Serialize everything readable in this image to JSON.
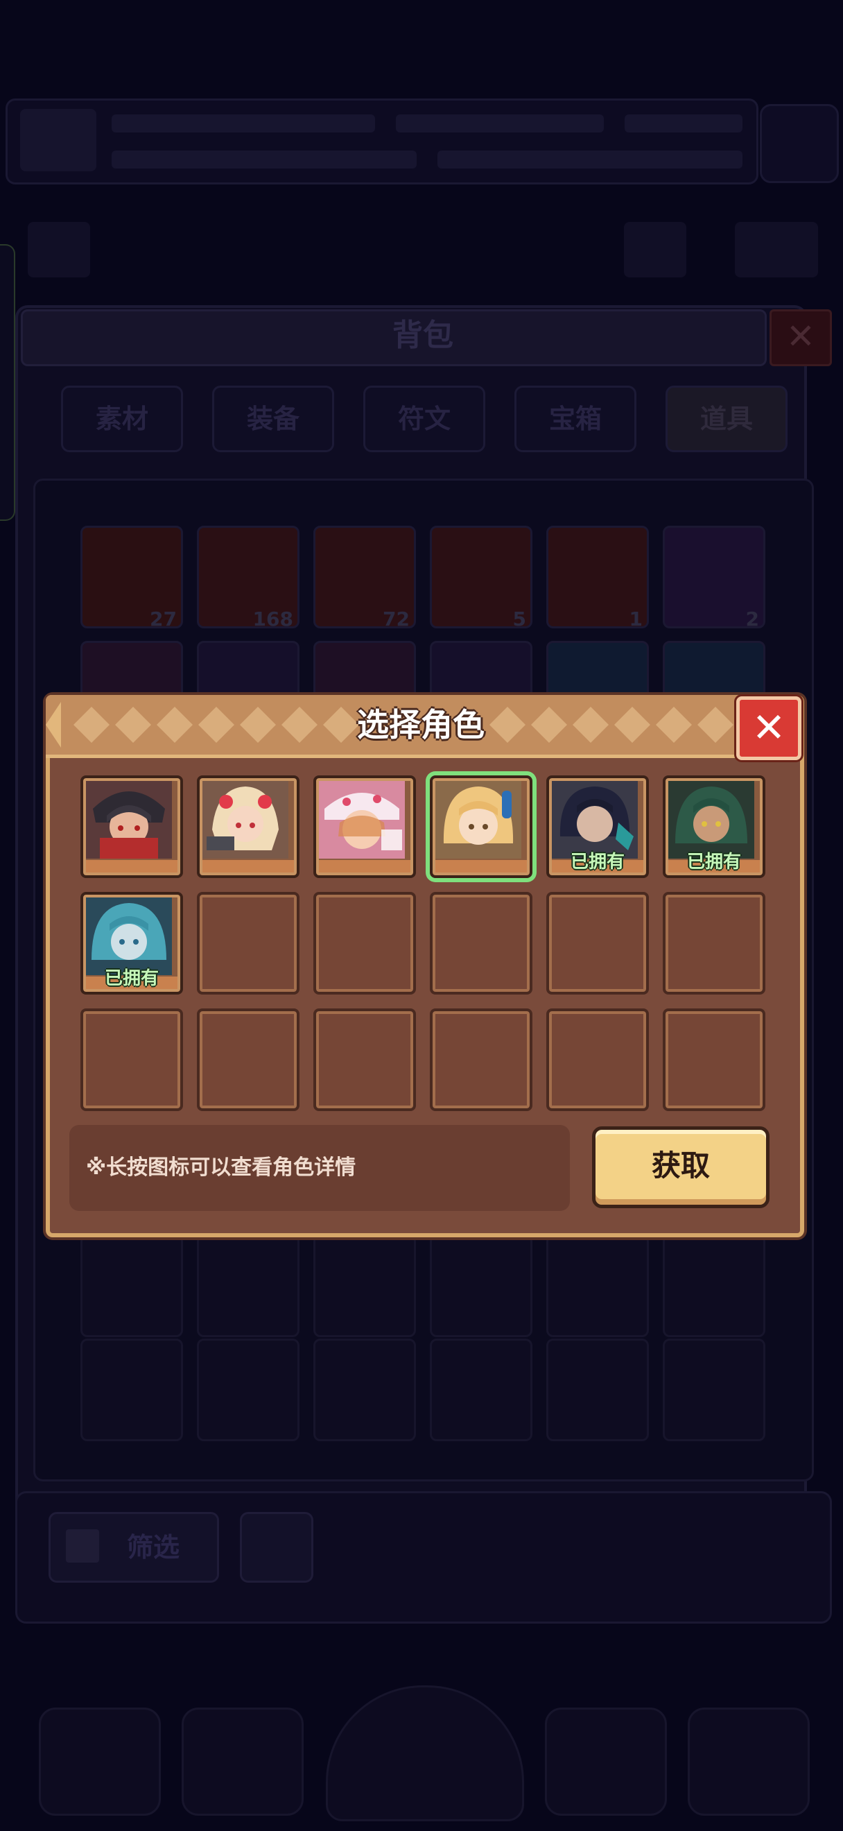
{
  "background": {
    "bag_title": "背包",
    "close_glyph": "✕",
    "tabs": [
      "素材",
      "装备",
      "符文",
      "宝箱",
      "道具"
    ],
    "active_tab": "道具",
    "items": [
      {
        "icon": "gem-icon",
        "count": "27",
        "color": "#2a0f12"
      },
      {
        "icon": "ticket-icon",
        "count": "168",
        "color": "#2a0f14"
      },
      {
        "icon": "letter-icon",
        "count": "72",
        "color": "#2a0f14"
      },
      {
        "icon": "crystal-icon",
        "count": "5",
        "color": "#2a0f14"
      },
      {
        "icon": "star-icon",
        "count": "1",
        "color": "#2a0f14"
      },
      {
        "icon": "purple-gem-icon",
        "count": "2",
        "color": "#1a0f2e"
      }
    ],
    "filter_label": "筛选"
  },
  "modal": {
    "title": "选择角色",
    "close_glyph": "✕",
    "characters": [
      {
        "name": "character-1",
        "owned": false,
        "selected": false
      },
      {
        "name": "character-2",
        "owned": false,
        "selected": false
      },
      {
        "name": "character-3",
        "owned": false,
        "selected": false
      },
      {
        "name": "character-4",
        "owned": false,
        "selected": true
      },
      {
        "name": "character-5",
        "owned": true,
        "selected": false,
        "owned_label": "已拥有"
      },
      {
        "name": "character-6",
        "owned": true,
        "selected": false,
        "owned_label": "已拥有"
      },
      {
        "name": "character-7",
        "owned": true,
        "selected": false,
        "owned_label": "已拥有"
      }
    ],
    "empty_slot_count": 11,
    "hint": "※长按图标可以查看角色详情",
    "get_button": "获取"
  },
  "colors": {
    "selected_outline": "#7fe07d",
    "owned_label": "#c6f7b9",
    "close_red": "#d93a34",
    "button_gold": "#f3d287",
    "panel_brown": "#7a4b3b"
  }
}
